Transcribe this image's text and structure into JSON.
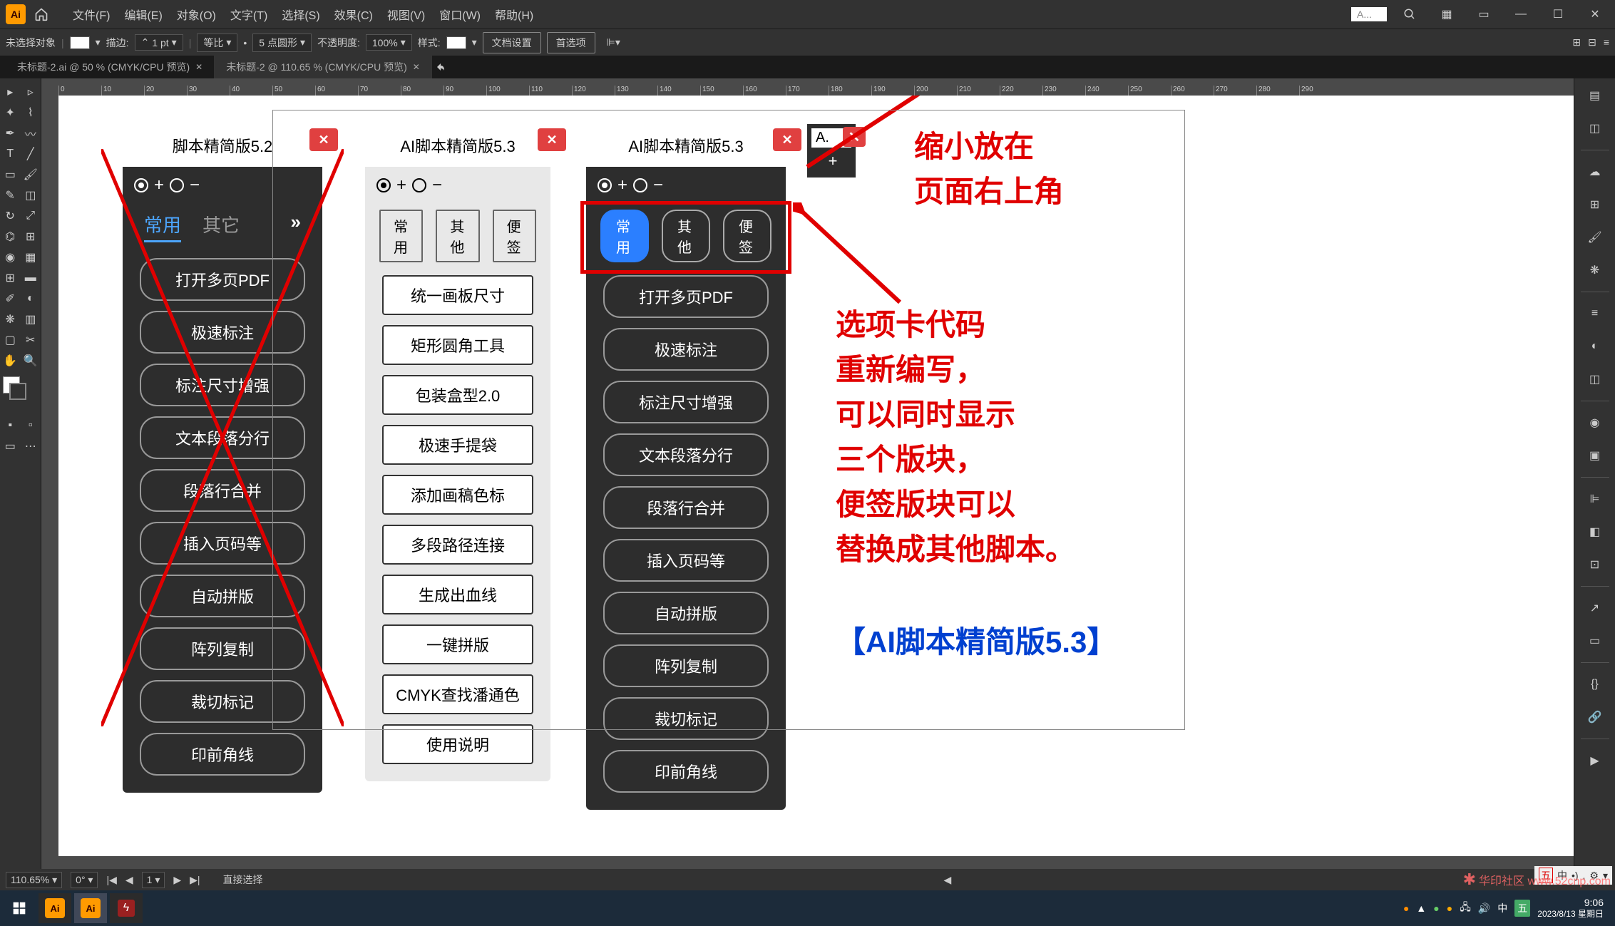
{
  "menubar": {
    "items": [
      "文件(F)",
      "编辑(E)",
      "对象(O)",
      "文字(T)",
      "选择(S)",
      "效果(C)",
      "视图(V)",
      "窗口(W)",
      "帮助(H)"
    ],
    "search_placeholder": "A..."
  },
  "optionsbar": {
    "noselection": "未选择对象",
    "stroke_label": "描边:",
    "stroke_value": "1 pt",
    "uniform": "等比",
    "brush": "5 点圆形",
    "opacity_label": "不透明度:",
    "opacity_value": "100%",
    "style_label": "样式:",
    "doc_setup": "文档设置",
    "prefs": "首选项"
  },
  "tabs": [
    {
      "label": "未标题-2.ai @ 50 % (CMYK/CPU 预览)",
      "active": false
    },
    {
      "label": "未标题-2 @ 110.65 % (CMYK/CPU 预览)",
      "active": true
    }
  ],
  "ruler_ticks": [
    "0",
    "10",
    "20",
    "30",
    "40",
    "50",
    "60",
    "70",
    "80",
    "90",
    "100",
    "110",
    "120",
    "130",
    "140",
    "150",
    "160",
    "170",
    "180",
    "190",
    "200",
    "210",
    "220",
    "230",
    "240",
    "250",
    "260",
    "270",
    "280",
    "290"
  ],
  "panel52": {
    "title": "脚本精简版5.2",
    "tabs": [
      "常用",
      "其它"
    ],
    "active_tab": 0,
    "buttons": [
      "打开多页PDF",
      "极速标注",
      "标注尺寸增强",
      "文本段落分行",
      "段落行合并",
      "插入页码等",
      "自动拼版",
      "阵列复制",
      "裁切标记",
      "印前角线"
    ]
  },
  "panel53light": {
    "title": "AI脚本精简版5.3",
    "tabs": [
      "常用",
      "其他",
      "便签"
    ],
    "buttons": [
      "统一画板尺寸",
      "矩形圆角工具",
      "包装盒型2.0",
      "极速手提袋",
      "添加画稿色标",
      "多段路径连接",
      "生成出血线",
      "一键拼版",
      "CMYK查找潘通色",
      "使用说明"
    ]
  },
  "panel53dark": {
    "title": "AI脚本精简版5.3",
    "tabs": [
      "常用",
      "其他",
      "便签"
    ],
    "active_tab": 0,
    "buttons": [
      "打开多页PDF",
      "极速标注",
      "标注尺寸增强",
      "文本段落分行",
      "段落行合并",
      "插入页码等",
      "自动拼版",
      "阵列复制",
      "裁切标记",
      "印前角线"
    ]
  },
  "mini_panel": {
    "title": "A."
  },
  "annotations": {
    "line1": "缩小放在",
    "line2": "页面右上角",
    "block2_l1": "选项卡代码",
    "block2_l2": "重新编写，",
    "block2_l3": "可以同时显示",
    "block2_l4": "三个版块，",
    "block2_l5": "便签版块可以",
    "block2_l6": "替换成其他脚本。",
    "blue": "【AI脚本精简版5.3】"
  },
  "statusbar": {
    "zoom": "110.65%",
    "rotate": "0°",
    "artboard": "1",
    "tool": "直接选择"
  },
  "taskbar": {
    "time": "9:06",
    "date": "2023/8/13 星期日"
  },
  "ime": {
    "items": [
      "五",
      "中",
      "•)",
      ",",
      "⚙",
      "▾"
    ]
  },
  "watermark": "华印社区 www.52cnp.com"
}
